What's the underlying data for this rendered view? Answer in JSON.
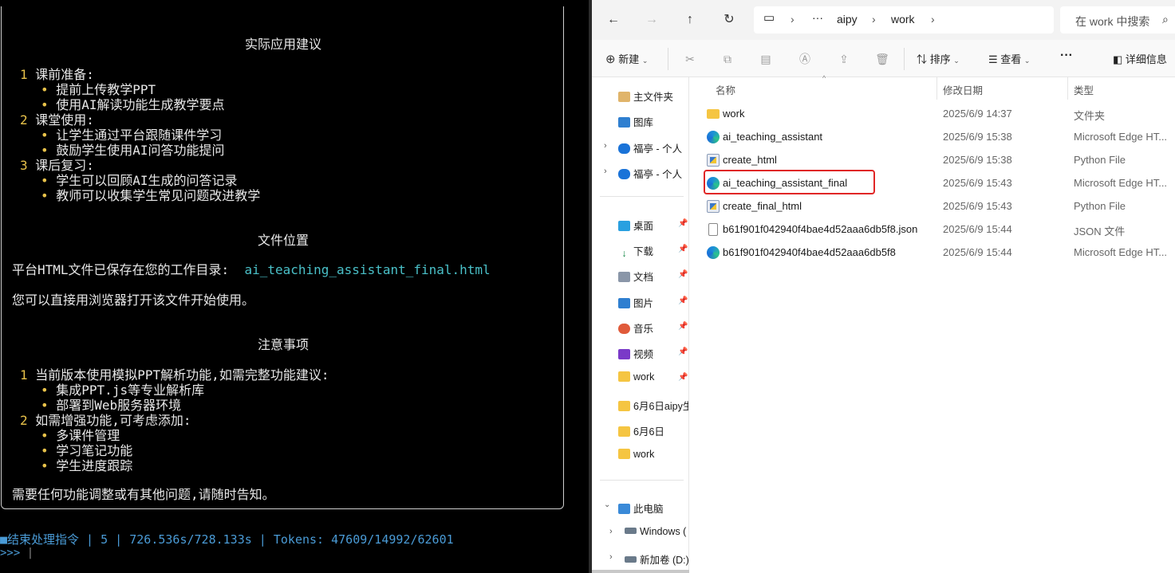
{
  "terminal": {
    "section1_title": "实际应用建议",
    "items1": [
      {
        "num": "1",
        "label": "课前准备:",
        "bullets": [
          "提前上传教学PPT",
          "使用AI解读功能生成教学要点"
        ]
      },
      {
        "num": "2",
        "label": "课堂使用:",
        "bullets": [
          "让学生通过平台跟随课件学习",
          "鼓励学生使用AI问答功能提问"
        ]
      },
      {
        "num": "3",
        "label": "课后复习:",
        "bullets": [
          "学生可以回顾AI生成的问答记录",
          "教师可以收集学生常见问题改进教学"
        ]
      }
    ],
    "section2_title": "文件位置",
    "file_line_prefix": "平台HTML文件已保存在您的工作目录:",
    "file_name": "ai_teaching_assistant_final.html",
    "file_line2": "您可以直接用浏览器打开该文件开始使用。",
    "section3_title": "注意事项",
    "items3": [
      {
        "num": "1",
        "label": "当前版本使用模拟PPT解析功能,如需完整功能建议:",
        "bullets": [
          "集成PPT.js等专业解析库",
          "部署到Web服务器环境"
        ]
      },
      {
        "num": "2",
        "label": "如需增强功能,可考虑添加:",
        "bullets": [
          "多课件管理",
          "学习笔记功能",
          "学生进度跟踪"
        ]
      }
    ],
    "closing": "需要任何功能调整或有其他问题,请随时告知。",
    "status_line": "■结束处理指令 | 5 | 726.536s/728.133s | Tokens: 47609/14992/62601",
    "prompt": ">>> "
  },
  "explorer": {
    "path": [
      "aipy",
      "work"
    ],
    "path_ellipsis": "···",
    "search_placeholder": "在 work 中搜索",
    "toolbar": {
      "new": "新建",
      "sort": "排序",
      "view": "查看",
      "more": "···",
      "details": "详细信息"
    },
    "nav": [
      {
        "label": "主文件夹",
        "icon": "home-icon"
      },
      {
        "label": "图库",
        "icon": "gallery-icon"
      },
      {
        "label": "福亭 - 个人",
        "icon": "onedrive-icon",
        "expandable": true
      },
      {
        "label": "福亭 - 个人",
        "icon": "onedrive-icon",
        "expandable": true
      },
      {
        "label": "桌面",
        "icon": "desktop-icon",
        "pinned": true
      },
      {
        "label": "下载",
        "icon": "download-icon",
        "pinned": true
      },
      {
        "label": "文档",
        "icon": "documents-icon",
        "pinned": true
      },
      {
        "label": "图片",
        "icon": "pictures-icon",
        "pinned": true
      },
      {
        "label": "音乐",
        "icon": "music-icon",
        "pinned": true
      },
      {
        "label": "视频",
        "icon": "videos-icon",
        "pinned": true
      },
      {
        "label": "work",
        "icon": "folder-icon",
        "pinned": true
      },
      {
        "label": "6月6日aipy生",
        "icon": "folder-icon"
      },
      {
        "label": "6月6日",
        "icon": "folder-icon"
      },
      {
        "label": "work",
        "icon": "folder-icon"
      },
      {
        "label": "此电脑",
        "icon": "pc-icon",
        "expandable": true,
        "expanded": true
      },
      {
        "label": "Windows (",
        "icon": "drive-icon",
        "expandable": true
      },
      {
        "label": "新加卷 (D:)",
        "icon": "drive-icon",
        "expandable": true
      }
    ],
    "columns": [
      "名称",
      "修改日期",
      "类型"
    ],
    "files": [
      {
        "name": "work",
        "date": "2025/6/9 14:37",
        "type": "文件夹",
        "icon": "folder"
      },
      {
        "name": "ai_teaching_assistant",
        "date": "2025/6/9 15:38",
        "type": "Microsoft Edge HT...",
        "icon": "edge"
      },
      {
        "name": "create_html",
        "date": "2025/6/9 15:38",
        "type": "Python File",
        "icon": "py"
      },
      {
        "name": "ai_teaching_assistant_final",
        "date": "2025/6/9 15:43",
        "type": "Microsoft Edge HT...",
        "icon": "edge"
      },
      {
        "name": "create_final_html",
        "date": "2025/6/9 15:43",
        "type": "Python File",
        "icon": "py"
      },
      {
        "name": "b61f901f042940f4bae4d52aaa6db5f8.json",
        "date": "2025/6/9 15:44",
        "type": "JSON 文件",
        "icon": "json"
      },
      {
        "name": "b61f901f042940f4bae4d52aaa6db5f8",
        "date": "2025/6/9 15:44",
        "type": "Microsoft Edge HT...",
        "icon": "edge"
      }
    ],
    "colors": {
      "highlight": "#e02626",
      "terminal_accent": "#e8c24a",
      "terminal_link": "#4ac0c8"
    }
  }
}
